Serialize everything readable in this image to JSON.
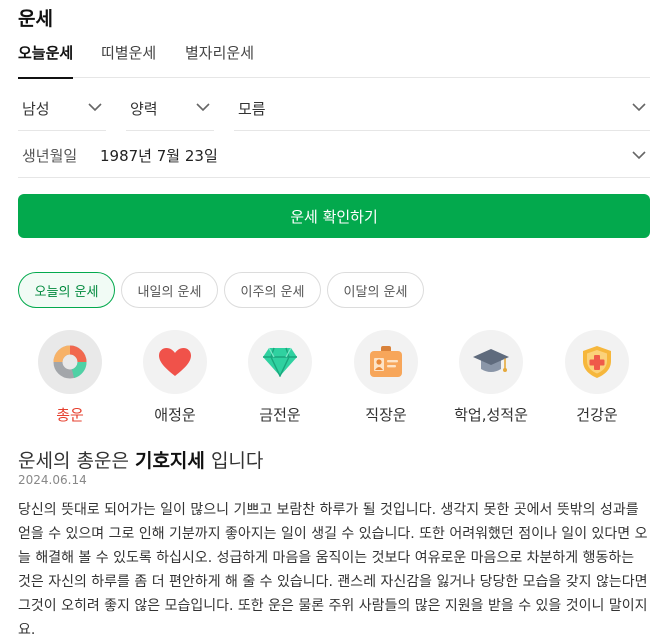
{
  "page_title": "운세",
  "tabs": [
    {
      "label": "오늘운세",
      "active": true
    },
    {
      "label": "띠별운세",
      "active": false
    },
    {
      "label": "별자리운세",
      "active": false
    }
  ],
  "form": {
    "gender": "남성",
    "calendar": "양력",
    "birth_time": "모름",
    "birth_label": "생년월일",
    "birth_value": "1987년 7월 23일"
  },
  "confirm_button": "운세 확인하기",
  "period_chips": [
    {
      "label": "오늘의 운세",
      "active": true
    },
    {
      "label": "내일의 운세",
      "active": false
    },
    {
      "label": "이주의 운세",
      "active": false
    },
    {
      "label": "이달의 운세",
      "active": false
    }
  ],
  "categories": [
    {
      "label": "총운",
      "icon": "donut-chart-icon",
      "active": true
    },
    {
      "label": "애정운",
      "icon": "heart-icon",
      "active": false
    },
    {
      "label": "금전운",
      "icon": "diamond-icon",
      "active": false
    },
    {
      "label": "직장운",
      "icon": "id-badge-icon",
      "active": false
    },
    {
      "label": "학업,성적운",
      "icon": "graduation-cap-icon",
      "active": false
    },
    {
      "label": "건강운",
      "icon": "health-shield-icon",
      "active": false
    }
  ],
  "result": {
    "headline_prefix": "운세의 총운은",
    "headline_keyword": "기호지세",
    "headline_suffix": "입니다",
    "date": "2024.06.14",
    "text": "당신의 뜻대로 되어가는 일이 많으니 기쁘고 보람찬 하루가 될 것입니다. 생각지 못한 곳에서 뜻밖의 성과를 얻을 수 있으며 그로 인해 기분까지 좋아지는 일이 생길 수 있습니다. 또한 어려워했던 점이나 일이 있다면 오늘 해결해 볼 수 있도록 하십시오. 성급하게 마음을 움직이는 것보다 여유로운 마음으로 차분하게 행동하는 것은 자신의 하루를 좀 더 편안하게 해 줄 수 있습니다. 괜스레 자신감을 잃거나 당당한 모습을 갖지 않는다면 그것이 오히려 좋지 않은 모습입니다. 또한 운은 물론 주위 사람들의 많은 지원을 받을 수 있을 것이니 말이지요."
  },
  "colors": {
    "accent": "#03a94d",
    "active_category": "#e6402f"
  }
}
